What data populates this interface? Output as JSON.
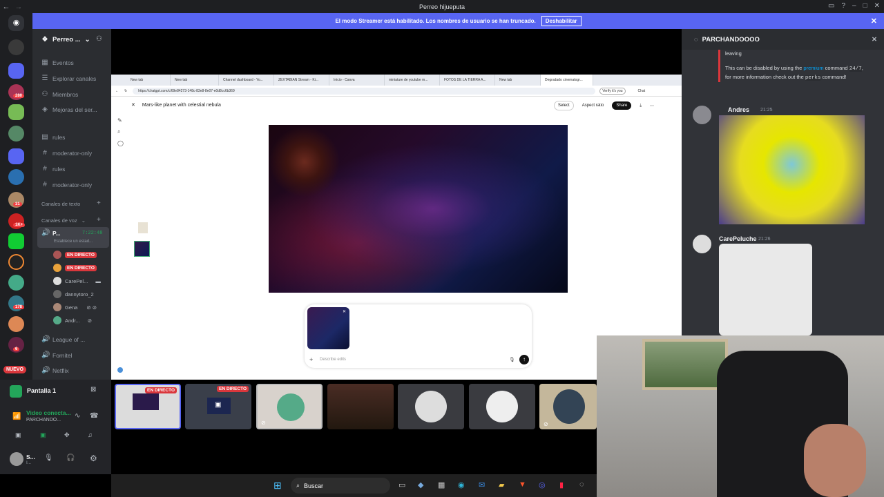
{
  "window": {
    "title": "Perreo hijueputa"
  },
  "streamer": {
    "message": "El modo Streamer está habilitado. Los nombres de usuario se han truncado.",
    "button": "Deshabilitar"
  },
  "servers": {
    "badges": [
      "280",
      "31",
      "1K+",
      "178",
      "6"
    ],
    "new_label": "NUEVO"
  },
  "channels": {
    "server_name": "Perreo ...",
    "nav": [
      "Eventos",
      "Explorar canales",
      "Miembros",
      "Mejoras del ser..."
    ],
    "text": [
      "rules",
      "moderator-only",
      "rules",
      "moderator-only"
    ],
    "cat_text": "Canales de texto",
    "cat_voice": "Canales de voz",
    "voice_active": {
      "name": "P...",
      "timer": "7:22:48",
      "status": "Establece un estad..."
    },
    "voice_users": [
      {
        "name": "EN DIRECTO"
      },
      {
        "name": "EN DIRECTO"
      },
      {
        "name": "CarePel..."
      },
      {
        "name": "dannytoro_2"
      },
      {
        "name": "Gena"
      },
      {
        "name": "Andr..."
      }
    ],
    "voice_channels": [
      "League of ...",
      "Fornitel",
      "Netflix"
    ]
  },
  "panel": {
    "screen_title": "Pantalla 1",
    "video": "Video conecta...",
    "sub": "PARCHANDO...",
    "user": "S...",
    "user_sub": "I..."
  },
  "browser": {
    "tabs": [
      "New tab",
      "New tab",
      "Channel dashboard - Yo...",
      "ZEXTABIAN Stream - Ki...",
      "Inicio - Canva",
      "miniature de youtube m...",
      "FOTOS DE LA TIERRA A...",
      "New tab",
      "Degradado cinematogr..."
    ],
    "url": "https://chatgpt.com/c/69e84273-148c-83e8-8e07-e0d8cc6b369",
    "verify": "Verify it's you",
    "chat": "Chat",
    "image_title": "Mars-like planet with celestial nebula",
    "select": "Select",
    "aspect": "Aspect ratio",
    "share": "Share",
    "composer_placeholder": "Describe edits"
  },
  "stream": {
    "live1": "EN DIRECTO",
    "live2": "EN DIRECTO"
  },
  "chat": {
    "channel": "PARCHANDOOOO",
    "bot_text_1": "leaving",
    "bot_text_2a": "This can be disabled by using the ",
    "bot_premium": "premium",
    "bot_text_2b": " command",
    "bot_cmd": "24/7",
    "bot_text_3a": ", for more information check out the ",
    "bot_perks": "perks",
    "bot_text_3b": "command!",
    "msg1": {
      "author": "Andres",
      "time": "21:25"
    },
    "msg2": {
      "author": "CarePeluche",
      "time": "21:26"
    }
  },
  "taskbar": {
    "search": "Buscar"
  },
  "colors": {
    "blurple": "#5865f2",
    "live": "#da373c",
    "sidebar": "#2b2d31",
    "chat": "#313338"
  }
}
